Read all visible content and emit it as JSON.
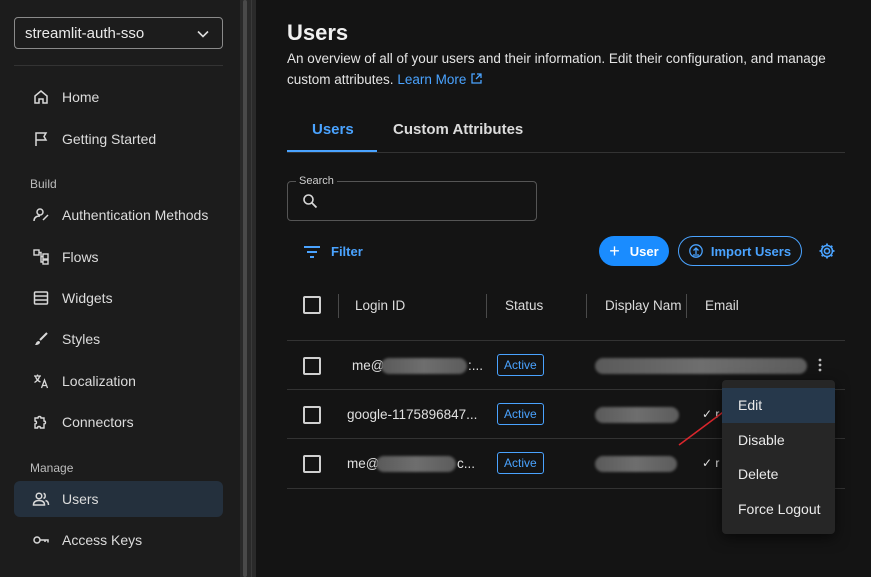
{
  "sidebar": {
    "project": "streamlit-auth-sso",
    "items": [
      {
        "label": "Home",
        "icon": "home-icon"
      },
      {
        "label": "Getting Started",
        "icon": "flag-icon"
      },
      {
        "label": "Authentication Methods",
        "icon": "user-key-icon"
      },
      {
        "label": "Flows",
        "icon": "flows-icon"
      },
      {
        "label": "Widgets",
        "icon": "widgets-icon"
      },
      {
        "label": "Styles",
        "icon": "brush-icon"
      },
      {
        "label": "Localization",
        "icon": "translate-icon"
      },
      {
        "label": "Connectors",
        "icon": "puzzle-icon"
      },
      {
        "label": "Users",
        "icon": "users-icon"
      },
      {
        "label": "Access Keys",
        "icon": "key-icon"
      }
    ],
    "sections": {
      "build": "Build",
      "manage": "Manage"
    },
    "active_item": "Users"
  },
  "header": {
    "title": "Users",
    "description": "An overview of all of your users and their information. Edit their configuration, and manage custom attributes.",
    "learn_more": "Learn More"
  },
  "tabs": [
    {
      "label": "Users",
      "active": true
    },
    {
      "label": "Custom Attributes",
      "active": false
    }
  ],
  "search": {
    "label": "Search",
    "value": ""
  },
  "toolbar": {
    "filter_label": "Filter",
    "add_user_label": "User",
    "import_label": "Import Users"
  },
  "table": {
    "columns": [
      "Login ID",
      "Status",
      "Display Nam",
      "Email"
    ],
    "rows": [
      {
        "login_prefix": "me@",
        "login_suffix": ":...",
        "status": "Active",
        "email_fragment": ""
      },
      {
        "login_prefix": "google-1175896847...",
        "login_suffix": "",
        "status": "Active",
        "email_fragment": "✓ r"
      },
      {
        "login_prefix": "me@",
        "login_suffix": "c...",
        "status": "Active",
        "email_fragment": "✓ r"
      }
    ]
  },
  "context_menu": {
    "items": [
      "Edit",
      "Disable",
      "Delete",
      "Force Logout"
    ],
    "highlighted": "Edit"
  },
  "colors": {
    "accent": "#4aa3ff",
    "primary_button": "#1a8cff",
    "background": "#141414",
    "sidebar": "#1c1c1c",
    "annotation_arrow": "#d9262c"
  }
}
